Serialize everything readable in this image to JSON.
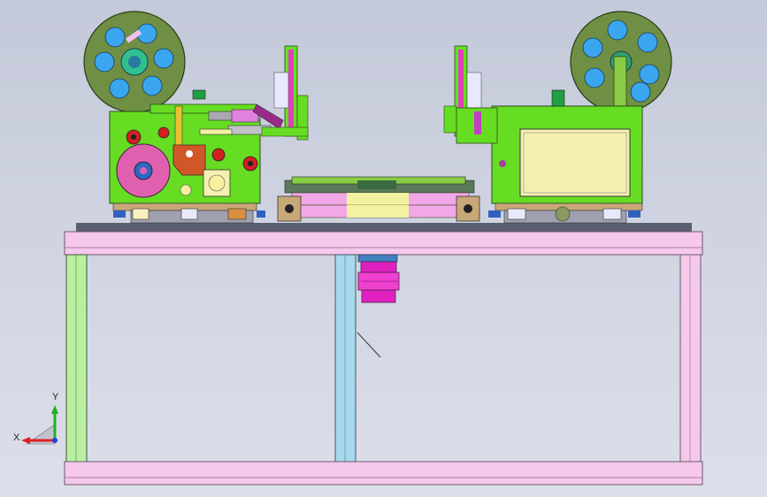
{
  "viewport": {
    "background_top": "#c4c9d9",
    "background_bottom": "#dcdfe9"
  },
  "axes": {
    "x_label": "X",
    "y_label": "Y",
    "x_color": "#e02020",
    "y_color": "#20b020",
    "z_color": "#2040e0"
  },
  "colors": {
    "frame": "#f6c8ec",
    "frame_left_leg": "#b8f0a0",
    "frame_center_post": "#a8d8ec",
    "top_plate": "#5a6070",
    "machine_green": "#66dd22",
    "reel_olive": "#6f8f44",
    "reel_hole": "#3aa6f0",
    "label_panel": "#f5f0b0",
    "motor_magenta": "#e020c0",
    "conveyor_pink": "#f2a8e8",
    "conveyor_yellow": "#f2f2a0",
    "block_tan": "#c8a878",
    "roller_red": "#d02020",
    "wheel_pink": "#e060b0",
    "bracket_orange": "#d05828"
  }
}
